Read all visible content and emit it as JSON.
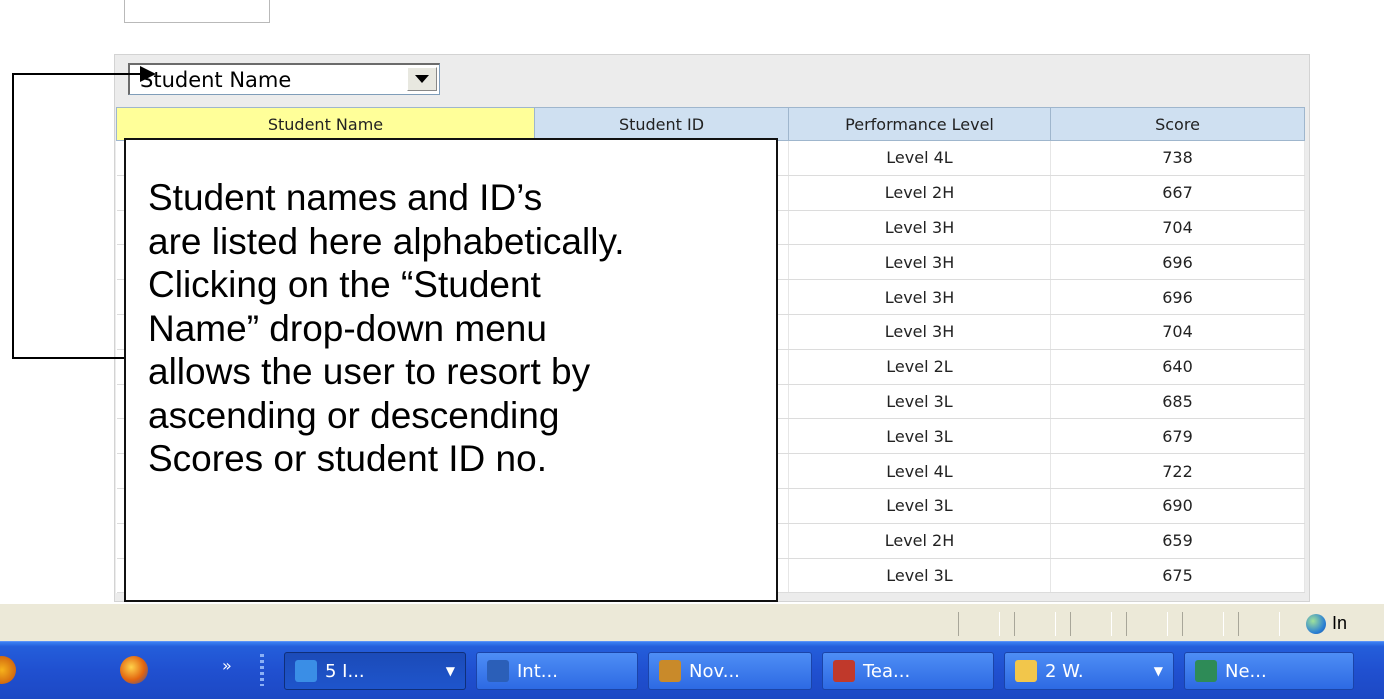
{
  "sort_control": {
    "selected": "Student Name"
  },
  "table": {
    "columns": [
      "Student Name",
      "Student ID",
      "Performance Level",
      "Score"
    ],
    "rows": [
      {
        "level": "Level 4L",
        "score": "738"
      },
      {
        "level": "Level 2H",
        "score": "667"
      },
      {
        "level": "Level 3H",
        "score": "704"
      },
      {
        "level": "Level 3H",
        "score": "696"
      },
      {
        "level": "Level 3H",
        "score": "696"
      },
      {
        "level": "Level 3H",
        "score": "704"
      },
      {
        "level": "Level 2L",
        "score": "640"
      },
      {
        "level": "Level 3L",
        "score": "685"
      },
      {
        "level": "Level 3L",
        "score": "679"
      },
      {
        "level": "Level 4L",
        "score": "722"
      },
      {
        "level": "Level 3L",
        "score": "690"
      },
      {
        "level": "Level 2H",
        "score": "659"
      },
      {
        "level": "Level 3L",
        "score": "675"
      }
    ]
  },
  "callout": {
    "text": "Student names and ID’s\nare listed here alphabetically.\nClicking on the “Student\nName” drop-down menu\nallows the user to resort by\nascending or descending\nScores or student ID no."
  },
  "statusbar": {
    "zone": "In"
  },
  "taskbar": {
    "tasks": [
      {
        "label": "5 I...",
        "has_arrow": true,
        "icon_color": "#3a8ee6"
      },
      {
        "label": "Int...",
        "has_arrow": false,
        "icon_color": "#2b5fb8"
      },
      {
        "label": "Nov...",
        "has_arrow": false,
        "icon_color": "#c98a2a"
      },
      {
        "label": "Tea...",
        "has_arrow": false,
        "icon_color": "#c0392b"
      },
      {
        "label": "2 W.",
        "has_arrow": true,
        "icon_color": "#f2c64b"
      },
      {
        "label": "Ne...",
        "has_arrow": false,
        "icon_color": "#2e8b57"
      }
    ]
  }
}
